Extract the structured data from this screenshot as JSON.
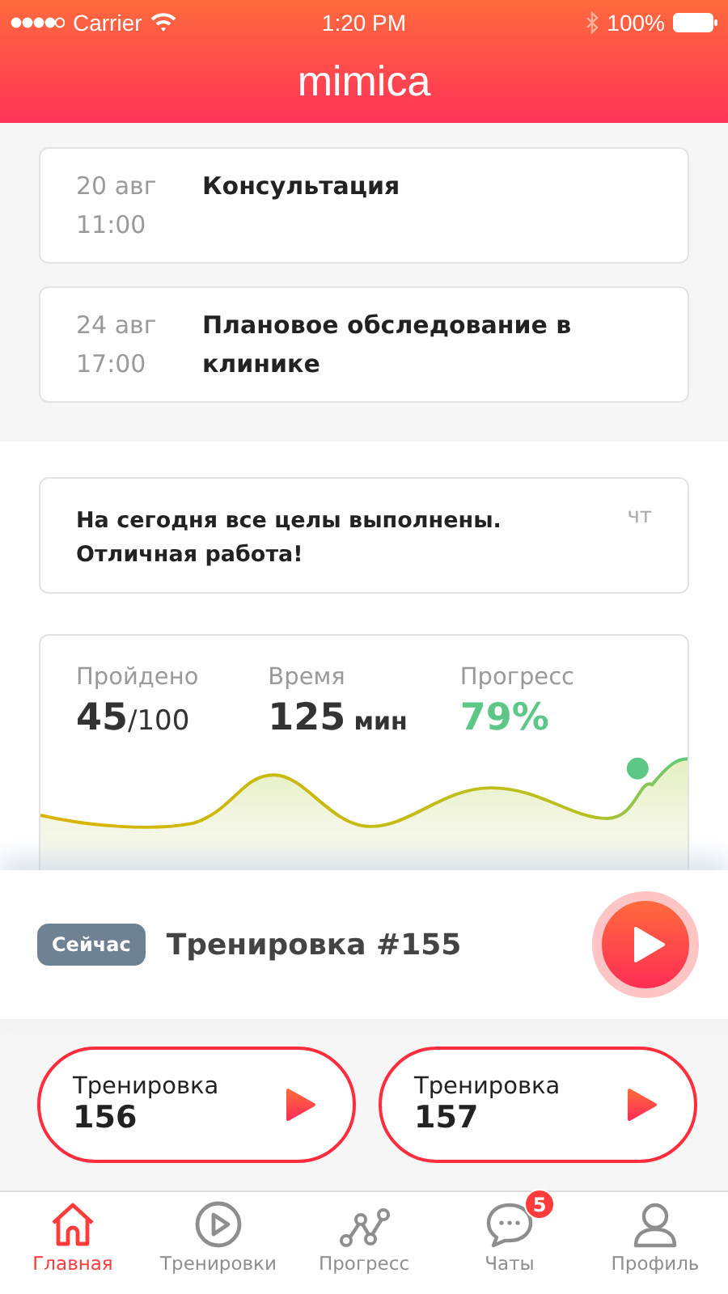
{
  "status_bar": {
    "carrier": "Carrier",
    "time": "1:20 PM",
    "battery": "100%"
  },
  "header": {
    "title": "mimica"
  },
  "appointments": [
    {
      "date": "20 авг",
      "time": "11:00",
      "title": "Консультация"
    },
    {
      "date": "24 авг",
      "time": "17:00",
      "title": "Плановое обследование в клинике"
    }
  ],
  "message": {
    "text": "На сегодня все целы выполнены. Отличная работа!",
    "day": "чт"
  },
  "stats": [
    {
      "label": "Пройдено",
      "value": "45",
      "unit": "/100",
      "kind": "plain"
    },
    {
      "label": "Время",
      "value": "125",
      "unit": "мин",
      "kind": "plain"
    },
    {
      "label": "Прогресс",
      "value": "79%",
      "kind": "accent"
    }
  ],
  "now": {
    "badge": "Сейчас",
    "title": "Тренировка #155"
  },
  "upcoming": [
    {
      "label": "Тренировка",
      "number": "156"
    },
    {
      "label": "Тренировка",
      "number": "157"
    }
  ],
  "tab_bar": [
    {
      "label": "Главная",
      "kind": "home",
      "selected": true
    },
    {
      "label": "Тренировки",
      "kind": "play",
      "selected": false
    },
    {
      "label": "Прогресс",
      "kind": "progress",
      "selected": false
    },
    {
      "label": "Чаты",
      "kind": "chat",
      "selected": false,
      "badge": "5"
    },
    {
      "label": "Профиль",
      "kind": "profile",
      "selected": false
    }
  ]
}
